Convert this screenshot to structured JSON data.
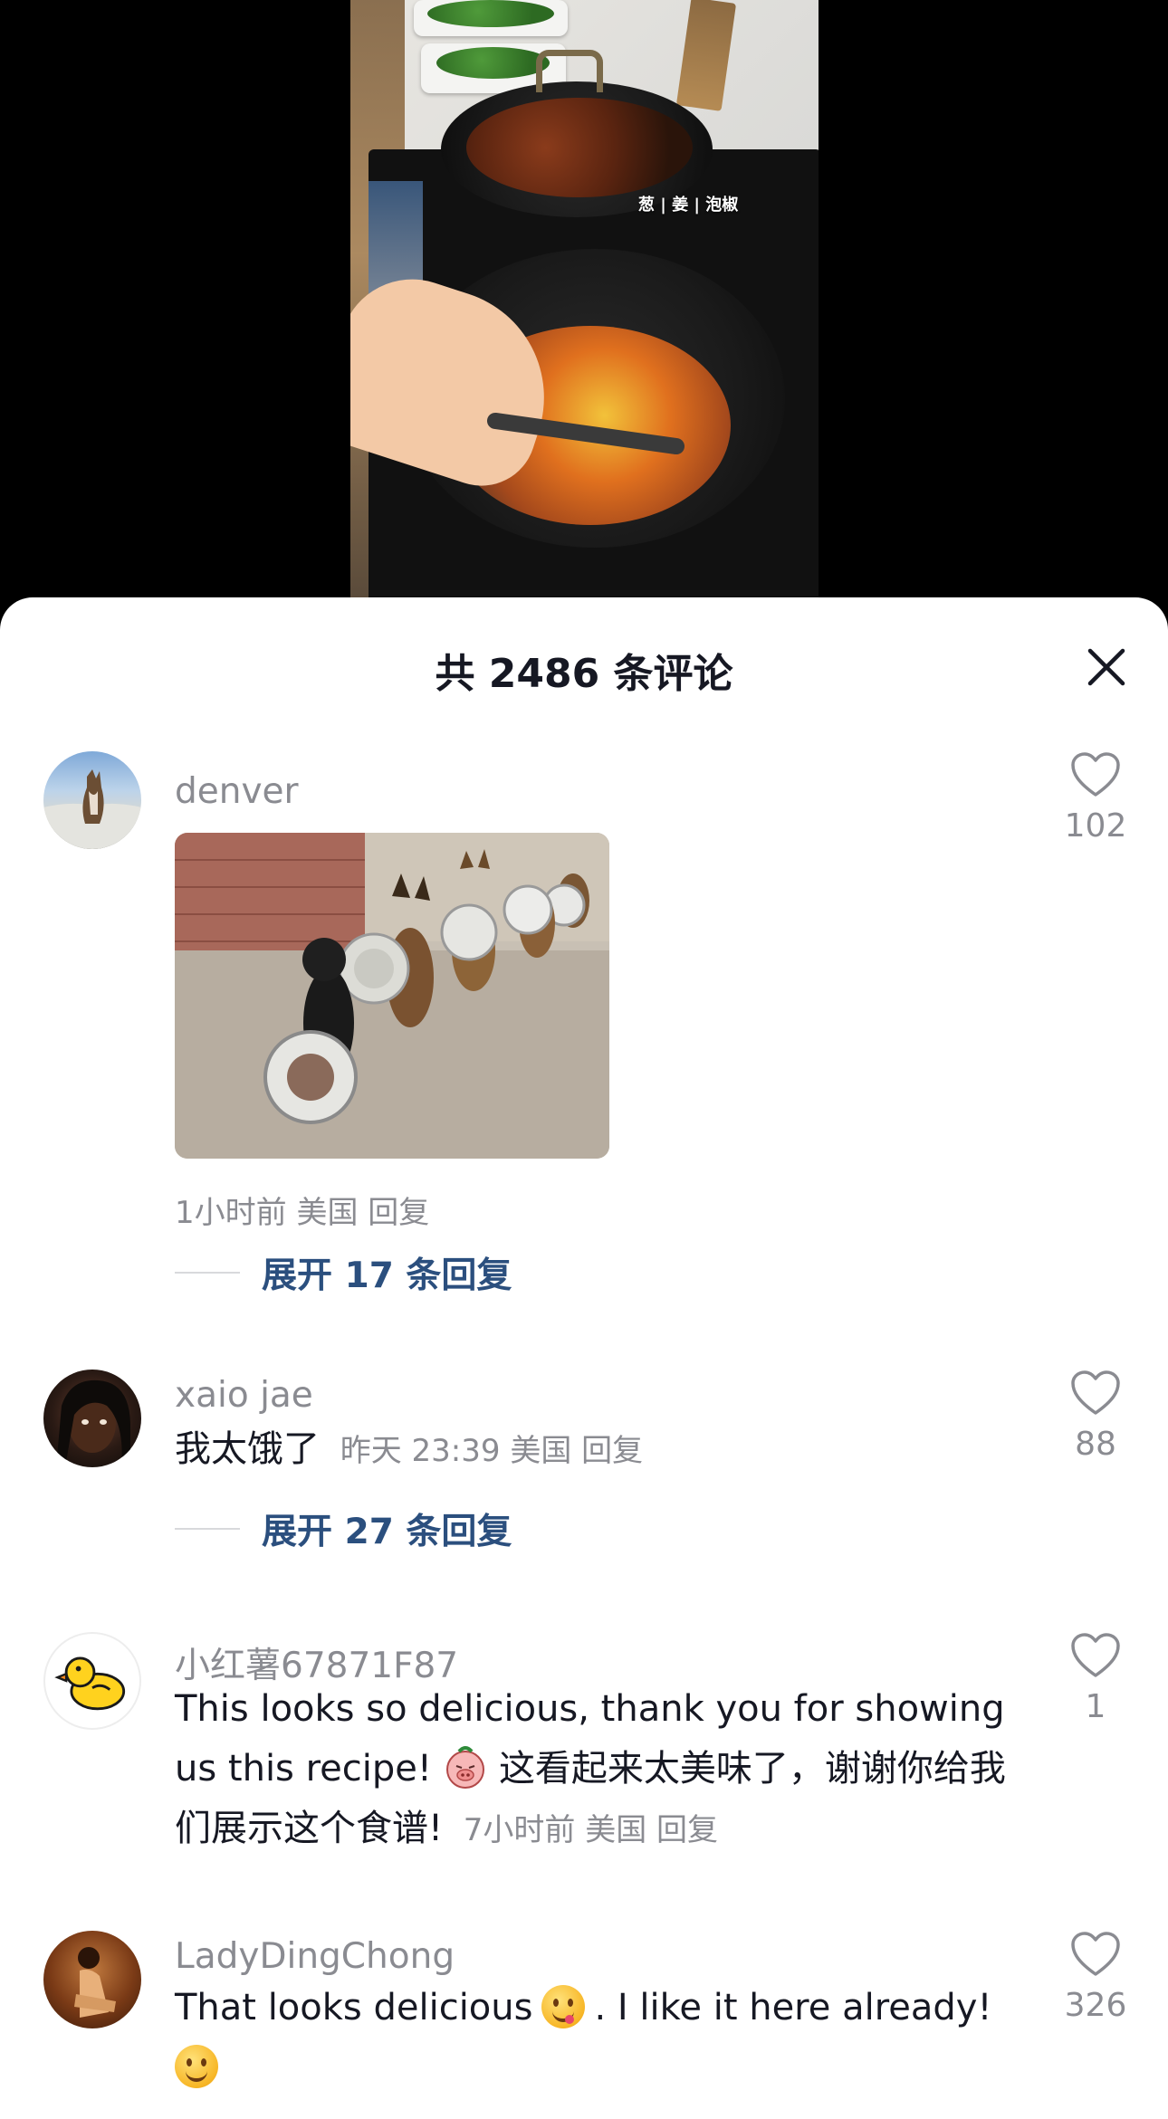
{
  "video": {
    "caption": "葱 | 姜 | 泡椒"
  },
  "sheet": {
    "title": "共 2486 条评论",
    "close_icon": "close-icon"
  },
  "comments": [
    {
      "username": "denver",
      "has_image": true,
      "meta": "1小时前 美国 回复",
      "likes": "102",
      "expand_label": "展开 17 条回复"
    },
    {
      "username": "xaio jae",
      "text": "我太饿了",
      "meta": "昨天 23:39 美国 回复",
      "likes": "88",
      "expand_label": "展开 27 条回复"
    },
    {
      "username": "小红薯67871F87",
      "text_part1": "This looks so delicious, thank you for showing us this recipe!",
      "text_part2": "这看起来太美味了，谢谢你给我们展示这个食谱!",
      "meta": "7小时前 美国 回复",
      "likes": "1"
    },
    {
      "username": "LadyDingChong",
      "text_part1": "That looks delicious",
      "text_part2": ". I like it here already!",
      "likes": "326"
    }
  ],
  "colors": {
    "accent_link": "#2b4f7e",
    "secondary_text": "#8a8b91",
    "primary_text": "#161823"
  }
}
